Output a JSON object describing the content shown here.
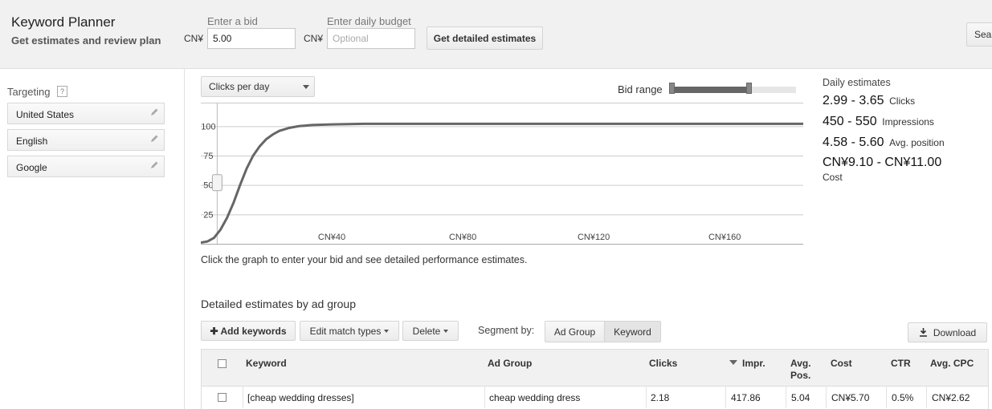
{
  "header": {
    "title": "Keyword Planner",
    "subtitle": "Get estimates and review plan",
    "bid_label": "Enter a bid",
    "bid_currency": "CN¥",
    "bid_value": "5.00",
    "budget_label": "Enter daily budget",
    "budget_currency": "CN¥",
    "budget_placeholder": "Optional",
    "estimates_button": "Get detailed estimates",
    "search_button": "Sea"
  },
  "targeting": {
    "label": "Targeting",
    "help": "?",
    "items": [
      {
        "label": "United States"
      },
      {
        "label": "English"
      },
      {
        "label": "Google"
      }
    ]
  },
  "chart_controls": {
    "metric_select": "Clicks per day",
    "bid_range_label": "Bid range",
    "bid_range_low": 0.0,
    "bid_range_high": 0.62
  },
  "chart_data": {
    "type": "line",
    "title": "",
    "xlabel": "",
    "ylabel": "Clicks per day",
    "x_ticks": [
      "CN¥40",
      "CN¥80",
      "CN¥120",
      "CN¥160"
    ],
    "x_tick_values": [
      40,
      80,
      120,
      160
    ],
    "y_ticks": [
      "25",
      "50",
      "75",
      "100"
    ],
    "y_tick_values": [
      25,
      50,
      75,
      100
    ],
    "xlim": [
      0,
      184
    ],
    "ylim": [
      0,
      120
    ],
    "grid": true,
    "series": [
      {
        "x": [
          0,
          2,
          4,
          6,
          8,
          10,
          12,
          14,
          16,
          18,
          20,
          22,
          24,
          27,
          30,
          34,
          40,
          50,
          60,
          80,
          120,
          160,
          184
        ],
        "y": [
          1,
          2,
          5,
          12,
          22,
          35,
          50,
          64,
          75,
          83,
          89,
          93,
          96,
          98.5,
          100,
          101,
          101.5,
          102,
          102,
          102,
          102,
          102,
          102
        ]
      }
    ],
    "current_bid_marker": 5.0
  },
  "chart_hint": "Click the graph to enter your bid and see detailed performance estimates.",
  "daily_estimates": {
    "title": "Daily estimates",
    "clicks": {
      "value": "2.99 - 3.65",
      "unit": "Clicks"
    },
    "impressions": {
      "value": "450 - 550",
      "unit": "Impressions"
    },
    "position": {
      "value": "4.58 - 5.60",
      "unit": "Avg. position"
    },
    "cost": {
      "value": "CN¥9.10 - CN¥11.00",
      "unit": "Cost"
    }
  },
  "detailed": {
    "title": "Detailed estimates by ad group",
    "add_keywords": "Add keywords",
    "edit_match_types": "Edit match types",
    "delete": "Delete",
    "segment_label": "Segment by:",
    "segment_ad_group": "Ad Group",
    "segment_keyword": "Keyword",
    "download": "Download"
  },
  "table": {
    "columns": {
      "keyword": "Keyword",
      "ad_group": "Ad Group",
      "clicks": "Clicks",
      "impr": "Impr.",
      "avg_pos_1": "Avg.",
      "avg_pos_2": "Pos.",
      "cost": "Cost",
      "ctr": "CTR",
      "avg_cpc": "Avg. CPC"
    },
    "rows": [
      {
        "keyword": "[cheap wedding dresses]",
        "ad_group": "cheap wedding dress",
        "clicks": "2.18",
        "impr": "417.86",
        "avg_pos": "5.04",
        "cost": "CN¥5.70",
        "ctr": "0.5%",
        "avg_cpc": "CN¥2.62"
      }
    ]
  },
  "colors": {
    "header_bg": "#f1f1f1",
    "line": "#666666",
    "grid": "#cccccc",
    "selected_segment": "#e4e4e4"
  }
}
